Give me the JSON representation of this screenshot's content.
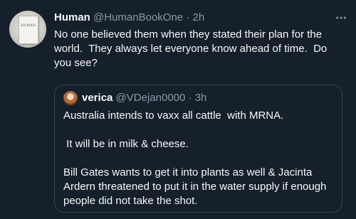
{
  "tweet": {
    "author_name": "Human",
    "handle": "@HumanBookOne",
    "separator": "·",
    "time": "2h",
    "text": "No one believed them when they stated their plan for the world.  They always let everyone know ahead of time.  Do you see?",
    "avatar_text": "HUMAN"
  },
  "quoted": {
    "author_name": "verica",
    "handle": "@VDejan0000",
    "separator": "·",
    "time": "3h",
    "text": "Australia intends to vaxx all cattle  with MRNA.\n\n It will be in milk & cheese.\n\nBill Gates wants to get it into plants as well & Jacinta Ardern threatened to put it in the water supply if enough people did not take the shot."
  },
  "icons": {
    "more": "more-horizontal-icon"
  },
  "colors": {
    "background": "#15202b",
    "primary_text": "#f7f9f9",
    "secondary_text": "#8b98a5",
    "border": "#38444d"
  }
}
